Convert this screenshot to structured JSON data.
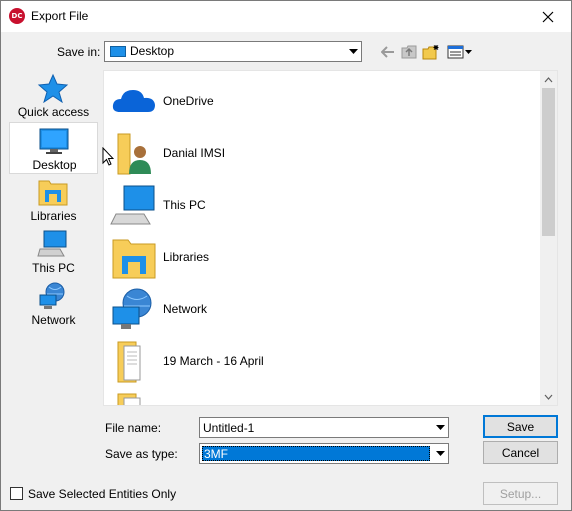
{
  "window": {
    "title": "Export File",
    "app_icon_text": "DC"
  },
  "save_in": {
    "label": "Save in:",
    "value": "Desktop"
  },
  "places": [
    {
      "label": "Quick access",
      "icon": "star-icon"
    },
    {
      "label": "Desktop",
      "icon": "desktop-icon",
      "selected": true
    },
    {
      "label": "Libraries",
      "icon": "libraries-icon"
    },
    {
      "label": "This PC",
      "icon": "computer-icon"
    },
    {
      "label": "Network",
      "icon": "network-icon"
    }
  ],
  "files": [
    {
      "name": "OneDrive",
      "icon": "cloud-icon"
    },
    {
      "name": "Danial IMSI",
      "icon": "user-folder-icon"
    },
    {
      "name": "This PC",
      "icon": "computer-icon"
    },
    {
      "name": "Libraries",
      "icon": "libraries-icon"
    },
    {
      "name": "Network",
      "icon": "network-icon"
    },
    {
      "name": "19 March - 16 April",
      "icon": "folder-icon"
    }
  ],
  "file_name": {
    "label": "File name:",
    "value": "Untitled-1"
  },
  "save_as_type": {
    "label": "Save as type:",
    "value": "3MF"
  },
  "buttons": {
    "save": "Save",
    "cancel": "Cancel",
    "setup": "Setup..."
  },
  "checkbox": {
    "label": "Save Selected Entities Only",
    "checked": false
  }
}
